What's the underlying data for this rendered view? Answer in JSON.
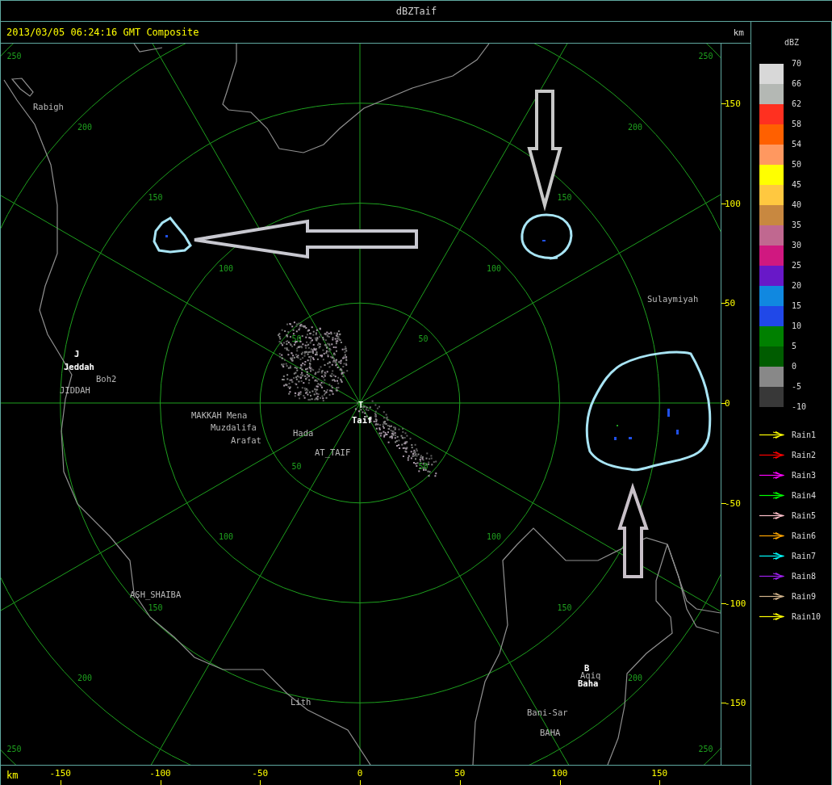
{
  "window": {
    "title": "dBZTaif"
  },
  "header": {
    "timestamp": "2013/03/05 06:24:16 GMT Composite",
    "unit": "km"
  },
  "map": {
    "rings": [
      {
        "labels": [
          "50",
          "50",
          "50",
          "50"
        ]
      },
      {
        "labels": [
          "100",
          "100",
          "100",
          "100"
        ]
      },
      {
        "labels": [
          "150",
          "150",
          "150",
          "150"
        ]
      },
      {
        "labels": [
          "200",
          "200",
          "200",
          "200"
        ]
      },
      {
        "labels": [
          "250",
          "250",
          "250",
          "250"
        ]
      }
    ],
    "places": [
      {
        "name": "Rabigh",
        "kind": "place"
      },
      {
        "name": "J",
        "kind": "site"
      },
      {
        "name": "Jeddah",
        "kind": "site"
      },
      {
        "name": "Boh2",
        "kind": "place"
      },
      {
        "name": "JIDDAH",
        "kind": "place"
      },
      {
        "name": "MAKKAH",
        "kind": "place"
      },
      {
        "name": "Mena",
        "kind": "place"
      },
      {
        "name": "Muzdalifa",
        "kind": "place"
      },
      {
        "name": "Arafat",
        "kind": "place"
      },
      {
        "name": "Hada",
        "kind": "place"
      },
      {
        "name": "AT_TAIF",
        "kind": "place"
      },
      {
        "name": "T",
        "kind": "site"
      },
      {
        "name": "Taif",
        "kind": "site"
      },
      {
        "name": "Sulaymiyah",
        "kind": "place"
      },
      {
        "name": "ASH_SHAIBA",
        "kind": "place"
      },
      {
        "name": "Lith",
        "kind": "place"
      },
      {
        "name": "B",
        "kind": "site"
      },
      {
        "name": "Aqiq",
        "kind": "place"
      },
      {
        "name": "Baha",
        "kind": "site"
      },
      {
        "name": "Bani-Sar",
        "kind": "place"
      },
      {
        "name": "BAHA",
        "kind": "place"
      }
    ]
  },
  "x_axis": {
    "unit": "km",
    "ticks": [
      "-150",
      "-100",
      "-50",
      "0",
      "50",
      "100",
      "150"
    ]
  },
  "y_axis": {
    "ticks": [
      "150",
      "100",
      "50",
      "0",
      "-50",
      "-100",
      "-150"
    ]
  },
  "legend": {
    "unit": "dBZ",
    "ticks": [
      "70",
      "66",
      "62",
      "58",
      "54",
      "50",
      "45",
      "40",
      "35",
      "30",
      "25",
      "20",
      "15",
      "10",
      "5",
      "0",
      "-5",
      "-10"
    ],
    "bands": [
      {
        "color": "#d8d8d8"
      },
      {
        "color": "#b4b8b4"
      },
      {
        "color": "#ff3020"
      },
      {
        "color": "#ff6000"
      },
      {
        "color": "#ff9860"
      },
      {
        "color": "#ffff00"
      },
      {
        "color": "#ffc840"
      },
      {
        "color": "#c88840"
      },
      {
        "color": "#c06890"
      },
      {
        "color": "#d01880"
      },
      {
        "color": "#6818c8"
      },
      {
        "color": "#1088e0"
      },
      {
        "color": "#2048e8"
      },
      {
        "color": "#008000"
      },
      {
        "color": "#005c00"
      },
      {
        "color": "#888888"
      },
      {
        "color": "#383838"
      }
    ],
    "rain_tracks": [
      {
        "label": "Rain1",
        "color": "#ffff00"
      },
      {
        "label": "Rain2",
        "color": "#ff0000"
      },
      {
        "label": "Rain3",
        "color": "#ff00ff"
      },
      {
        "label": "Rain4",
        "color": "#00ff00"
      },
      {
        "label": "Rain5",
        "color": "#ffc0cb"
      },
      {
        "label": "Rain6",
        "color": "#ffa500"
      },
      {
        "label": "Rain7",
        "color": "#00ffff"
      },
      {
        "label": "Rain8",
        "color": "#a020f0"
      },
      {
        "label": "Rain9",
        "color": "#d2b48c"
      },
      {
        "label": "Rain10",
        "color": "#ffff00"
      }
    ]
  }
}
